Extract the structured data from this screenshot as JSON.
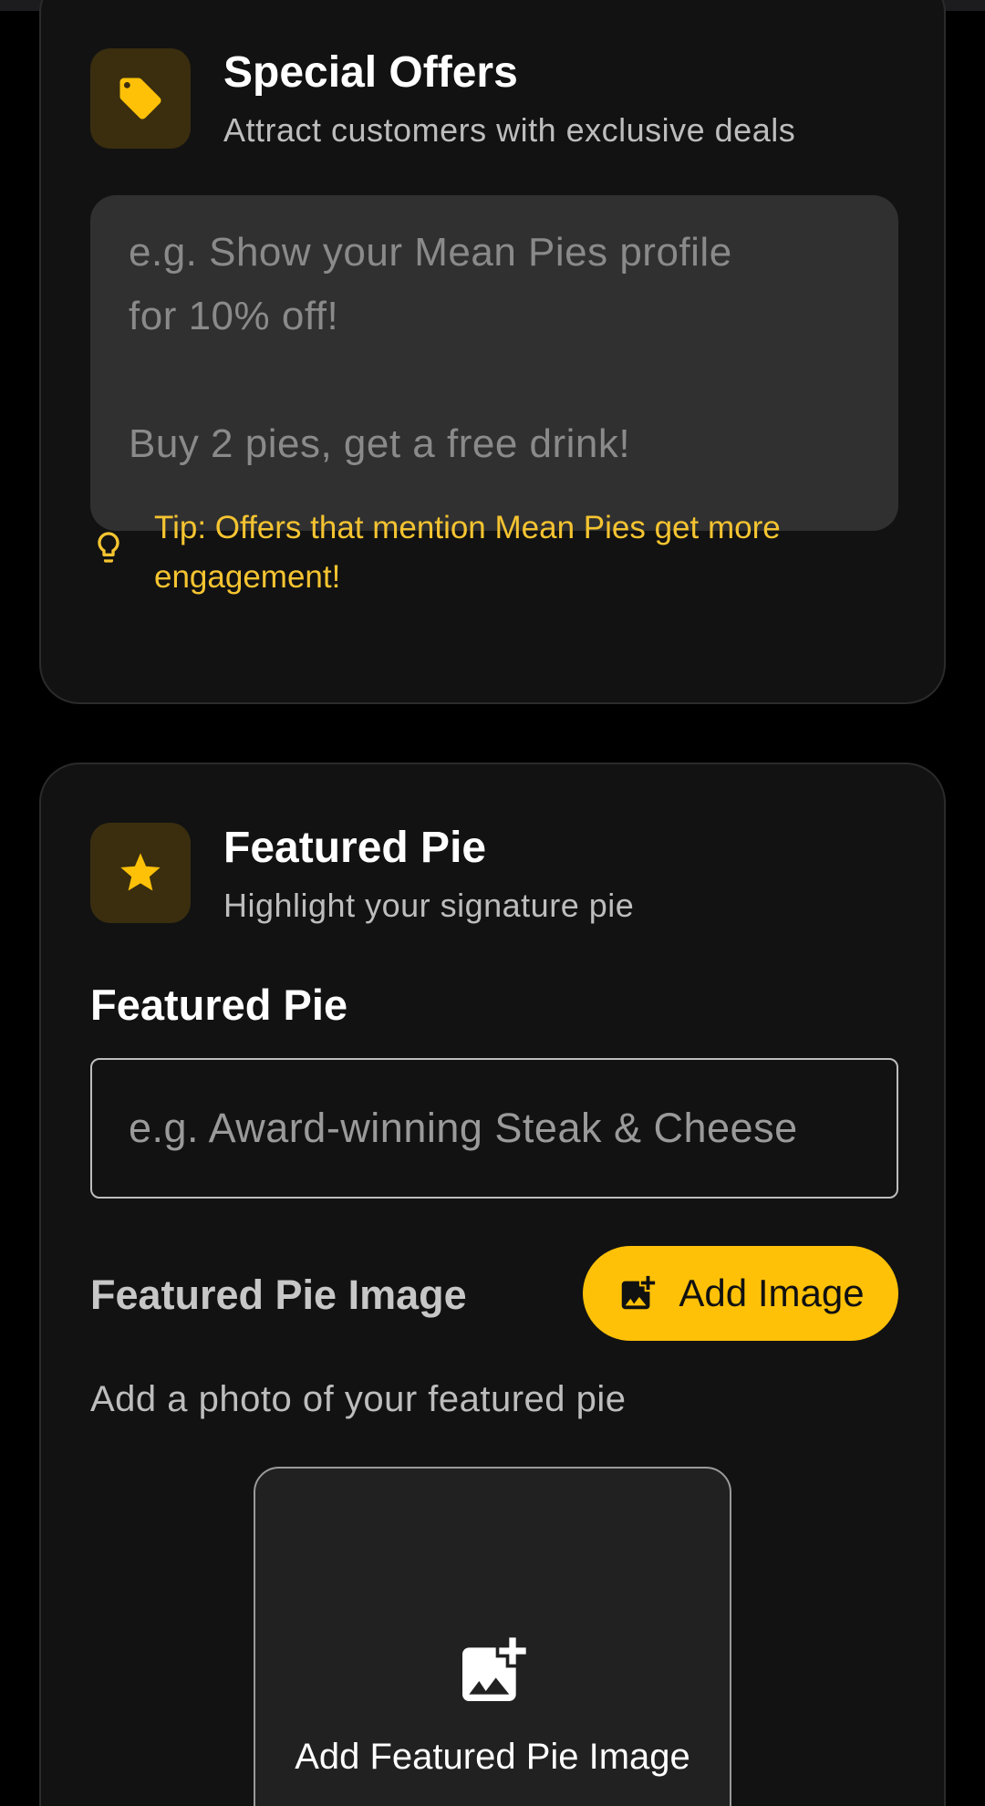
{
  "offers": {
    "title": "Special Offers",
    "subtitle": "Attract customers with exclusive deals",
    "icon": "tag-icon",
    "placeholder": "e.g. Show your Mean Pies profile\nfor 10% off!\n\nBuy 2 pies, get a free drink!",
    "tip": "Tip: Offers that mention Mean Pies get more engagement!"
  },
  "featured": {
    "title": "Featured Pie",
    "subtitle": "Highlight your signature pie",
    "icon": "star-icon",
    "field_label": "Featured Pie",
    "field_placeholder": "e.g. Award-winning Steak & Cheese",
    "image_label": "Featured Pie Image",
    "add_image_button": "Add Image",
    "image_help": "Add a photo of your featured pie",
    "image_box_label": "Add Featured Pie Image"
  },
  "colors": {
    "accent": "#ffc107",
    "card_bg": "#121212",
    "icon_tile_bg": "#3a2e0f",
    "tip_text": "#f5c431"
  }
}
